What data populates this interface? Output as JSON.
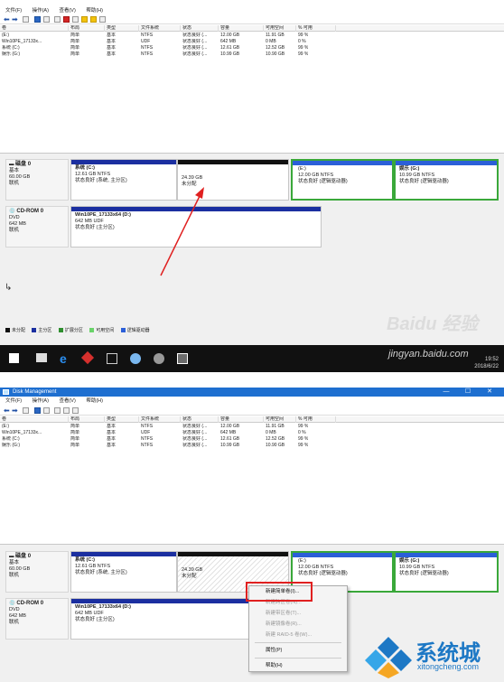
{
  "window": {
    "title": "Disk Management"
  },
  "menu": [
    "文件(F)",
    "操作(A)",
    "查看(V)",
    "帮助(H)"
  ],
  "window_controls": [
    "—",
    "☐",
    "✕"
  ],
  "volume_columns": [
    "卷",
    "布局",
    "类型",
    "文件系统",
    "状态",
    "容量",
    "可用空间",
    "% 可用"
  ],
  "volumes": [
    {
      "name": "(E:)",
      "layout": "简单",
      "type": "基本",
      "fs": "NTFS",
      "status": "状态良好 (...",
      "capacity": "12.00 GB",
      "free": "11.91 GB",
      "pct": "99 %"
    },
    {
      "name": "Win10PE_17133x...",
      "layout": "简单",
      "type": "基本",
      "fs": "UDF",
      "status": "状态良好 (...",
      "capacity": "642 MB",
      "free": "0 MB",
      "pct": "0 %"
    },
    {
      "name": "系统 (C:)",
      "layout": "简单",
      "type": "基本",
      "fs": "NTFS",
      "status": "状态良好 (...",
      "capacity": "12.61 GB",
      "free": "12.52 GB",
      "pct": "99 %"
    },
    {
      "name": "娱乐 (G:)",
      "layout": "简单",
      "type": "基本",
      "fs": "NTFS",
      "status": "状态良好 (...",
      "capacity": "10.99 GB",
      "free": "10.90 GB",
      "pct": "99 %"
    }
  ],
  "disk0": {
    "name": "磁盘 0",
    "type": "基本",
    "size": "60.00 GB",
    "state": "联机",
    "partitions": {
      "c": {
        "title": "系统 (C:)",
        "line1": "12.61 GB NTFS",
        "line2": "状态良好 (系统, 主分区)"
      },
      "unalloc": {
        "line1": "24.39 GB",
        "line2": "未分配"
      },
      "e": {
        "title": "(E:)",
        "line1": "12.00 GB NTFS",
        "line2": "状态良好 (逻辑驱动器)"
      },
      "g": {
        "title": "娱乐 (G:)",
        "line1": "10.99 GB NTFS",
        "line2": "状态良好 (逻辑驱动器)"
      }
    }
  },
  "cdrom0": {
    "name": "CD-ROM 0",
    "type": "DVD",
    "size": "642 MB",
    "state": "联机",
    "partition": {
      "title": "Win10PE_17133x64 (D:)",
      "line1": "642 MB UDF",
      "line2": "状态良好 (主分区)"
    }
  },
  "legend": [
    {
      "label": "未分配",
      "color": "#111111"
    },
    {
      "label": "主分区",
      "color": "#1b2fa0"
    },
    {
      "label": "扩展分区",
      "color": "#2f8f2f"
    },
    {
      "label": "可用空间",
      "color": "#6ad36a"
    },
    {
      "label": "逻辑驱动器",
      "color": "#2b5fd8"
    }
  ],
  "context_menu": [
    {
      "label": "新建简单卷(I)...",
      "enabled": true
    },
    {
      "label": "新建跨区卷(N)...",
      "enabled": false
    },
    {
      "label": "新建带区卷(T)...",
      "enabled": false
    },
    {
      "label": "新建镜像卷(R)...",
      "enabled": false
    },
    {
      "label": "新建 RAID-5 卷(W)...",
      "enabled": false
    },
    {
      "label": "属性(P)",
      "enabled": true
    },
    {
      "label": "帮助(H)",
      "enabled": true
    }
  ],
  "taskbar": {
    "clock_time": "19:52",
    "clock_date": "2018/6/22"
  },
  "watermarks": {
    "baidu": "Baidu 经验",
    "jingyan": "jingyan.baidu.com"
  },
  "brand": {
    "name": "系统城",
    "url": "xitongcheng.com",
    "accent": "#1d78c5"
  }
}
